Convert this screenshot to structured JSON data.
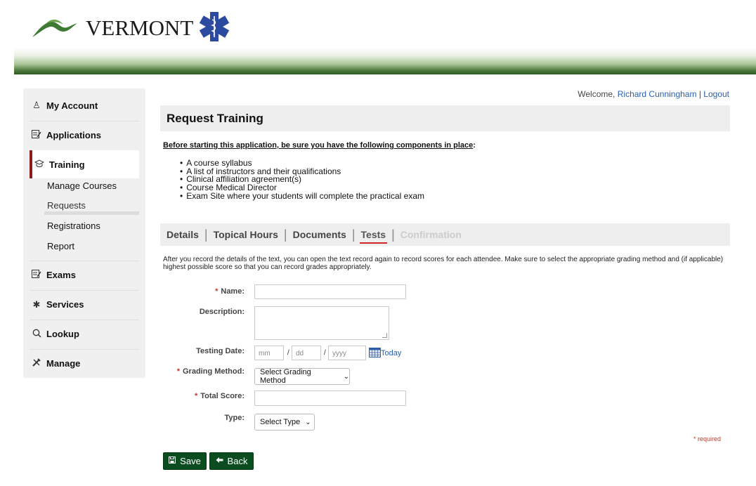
{
  "header": {
    "logo_text": "VERMONT"
  },
  "sidebar": {
    "items": [
      {
        "label": "My Account",
        "icon": "person-icon"
      },
      {
        "label": "Applications",
        "icon": "document-edit-icon"
      },
      {
        "label": "Training",
        "icon": "graduation-cap-icon"
      },
      {
        "label": "Exams",
        "icon": "document-edit-icon"
      },
      {
        "label": "Services",
        "icon": "star-of-life-icon"
      },
      {
        "label": "Lookup",
        "icon": "search-icon"
      },
      {
        "label": "Manage",
        "icon": "tools-icon"
      }
    ],
    "training_sub": [
      "Manage Courses",
      "Requests",
      "Registrations",
      "Report"
    ],
    "active": "Training",
    "active_sub": "Requests"
  },
  "welcome": {
    "prefix": "Welcome,",
    "user": "Richard Cunningham",
    "separator": "|",
    "logout": "Logout"
  },
  "page": {
    "title": "Request Training",
    "before_text": "Before starting this application, be sure you have the following components in place",
    "before_colon": ":",
    "components": [
      "A course syllabus",
      "A list of instructors and their qualifications",
      "Clinical affiliation agreement(s)",
      "Course Medical Director",
      "Exam Site where your students will complete the practical exam"
    ]
  },
  "tabs": [
    {
      "label": "Details",
      "state": "normal"
    },
    {
      "label": "Topical Hours",
      "state": "normal"
    },
    {
      "label": "Documents",
      "state": "normal"
    },
    {
      "label": "Tests",
      "state": "active"
    },
    {
      "label": "Confirmation",
      "state": "disabled"
    }
  ],
  "info_text": "After you record the details of the text, you can open the text record again to record scores for each attendee. Make sure to select the appropriate grading method and (if applicable) highest possible score so that you can record grades appropriately.",
  "form": {
    "name_label": "Name:",
    "name_value": "",
    "description_label": "Description:",
    "description_value": "",
    "testing_date_label": "Testing Date:",
    "date_mm_placeholder": "mm",
    "date_dd_placeholder": "dd",
    "date_yyyy_placeholder": "yyyy",
    "date_slash": "/",
    "today_label": "Today",
    "grading_method_label": "Grading Method:",
    "grading_method_value": "Select Grading Method",
    "total_score_label": "Total Score:",
    "total_score_value": "",
    "type_label": "Type:",
    "type_value": "Select Type",
    "required_mark": "*",
    "required_note": "* required"
  },
  "buttons": {
    "save": "Save",
    "back": "Back"
  },
  "colors": {
    "accent_green": "#0b4d20",
    "active_tab_underline": "#d4252a",
    "active_sidebar_bar": "#8b1c1c",
    "link": "#2a5ea8",
    "required": "#c0392b"
  }
}
